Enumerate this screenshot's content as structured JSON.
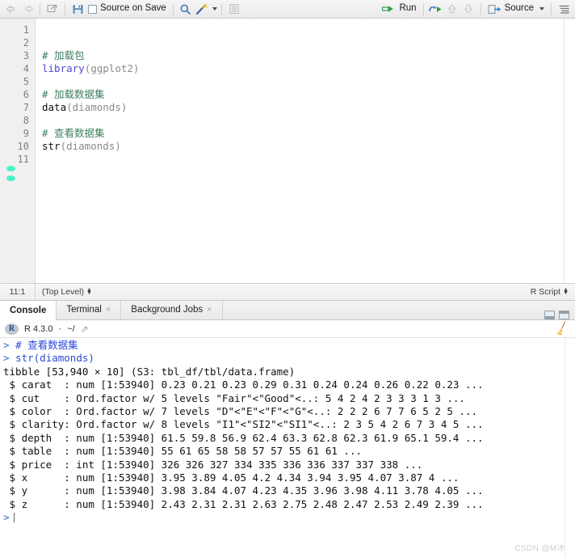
{
  "source_toolbar": {
    "back_icon": "back-arrow-icon",
    "forward_icon": "forward-arrow-icon",
    "popout_icon": "show-in-new-window-icon",
    "save_icon": "save-icon",
    "source_on_save_label": "Source on Save",
    "find_icon": "magnifier-icon",
    "codetools_icon": "magic-wand-icon",
    "compile_report_icon": "compile-report-icon",
    "run_label": "Run",
    "run_icon": "run-icon",
    "rerun_icon": "rerun-icon",
    "prev_chunk_icon": "arrow-up-icon",
    "next_chunk_icon": "arrow-down-icon",
    "source_label": "Source",
    "source_icon": "source-icon",
    "outline_icon": "document-outline-icon"
  },
  "editor": {
    "line_numbers": [
      "1",
      "2",
      "3",
      "4",
      "5",
      "6",
      "7",
      "8",
      "9",
      "10",
      "11"
    ],
    "lines": [
      {
        "n": "1",
        "segments": []
      },
      {
        "n": "2",
        "segments": []
      },
      {
        "n": "3",
        "segments": [
          {
            "t": "# 加载包",
            "c": "cmt"
          }
        ]
      },
      {
        "n": "4",
        "segments": [
          {
            "t": "library",
            "c": "kw"
          },
          {
            "t": "(ggplot2)",
            "c": "paren"
          }
        ]
      },
      {
        "n": "5",
        "segments": []
      },
      {
        "n": "6",
        "segments": [
          {
            "t": "# 加载数据集",
            "c": "cmt"
          }
        ]
      },
      {
        "n": "7",
        "segments": [
          {
            "t": "data",
            "c": "fn"
          },
          {
            "t": "(diamonds)",
            "c": "paren"
          }
        ]
      },
      {
        "n": "8",
        "segments": []
      },
      {
        "n": "9",
        "segments": [
          {
            "t": "# 查看数据集",
            "c": "cmt"
          }
        ]
      },
      {
        "n": "10",
        "segments": [
          {
            "t": "str",
            "c": "fn"
          },
          {
            "t": "(diamonds)",
            "c": "paren"
          }
        ]
      },
      {
        "n": "11",
        "segments": []
      }
    ]
  },
  "source_status": {
    "cursor_position": "11:1",
    "scope": "(Top Level)",
    "file_type": "R Script"
  },
  "console_tabs": [
    {
      "label": "Console",
      "closable": false,
      "active": true
    },
    {
      "label": "Terminal",
      "closable": true,
      "active": false
    },
    {
      "label": "Background Jobs",
      "closable": true,
      "active": false
    }
  ],
  "console_header": {
    "r_logo_text": "R",
    "version": "R 4.3.0",
    "separator": "·",
    "working_dir": "~/",
    "popout_icon": "open-in-new-window-icon",
    "clear_icon": "broom-clear-console-icon"
  },
  "console_output": [
    {
      "type": "input",
      "prompt": "> ",
      "text": "# 查看数据集"
    },
    {
      "type": "input",
      "prompt": "> ",
      "text": "str(diamonds)"
    },
    {
      "type": "output",
      "text": "tibble [53,940 × 10] (S3: tbl_df/tbl/data.frame)"
    },
    {
      "type": "output",
      "text": " $ carat  : num [1:53940] 0.23 0.21 0.23 0.29 0.31 0.24 0.24 0.26 0.22 0.23 ..."
    },
    {
      "type": "output",
      "text": " $ cut    : Ord.factor w/ 5 levels \"Fair\"<\"Good\"<..: 5 4 2 4 2 3 3 3 1 3 ..."
    },
    {
      "type": "output",
      "text": " $ color  : Ord.factor w/ 7 levels \"D\"<\"E\"<\"F\"<\"G\"<..: 2 2 2 6 7 7 6 5 2 5 ..."
    },
    {
      "type": "output",
      "text": " $ clarity: Ord.factor w/ 8 levels \"I1\"<\"SI2\"<\"SI1\"<..: 2 3 5 4 2 6 7 3 4 5 ..."
    },
    {
      "type": "output",
      "text": " $ depth  : num [1:53940] 61.5 59.8 56.9 62.4 63.3 62.8 62.3 61.9 65.1 59.4 ..."
    },
    {
      "type": "output",
      "text": " $ table  : num [1:53940] 55 61 65 58 58 57 57 55 61 61 ..."
    },
    {
      "type": "output",
      "text": " $ price  : int [1:53940] 326 326 327 334 335 336 336 337 337 338 ..."
    },
    {
      "type": "output",
      "text": " $ x      : num [1:53940] 3.95 3.89 4.05 4.2 4.34 3.94 3.95 4.07 3.87 4 ..."
    },
    {
      "type": "output",
      "text": " $ y      : num [1:53940] 3.98 3.84 4.07 4.23 4.35 3.96 3.98 4.11 3.78 4.05 ..."
    },
    {
      "type": "output",
      "text": " $ z      : num [1:53940] 2.43 2.31 2.31 2.63 2.75 2.48 2.47 2.53 2.49 2.39 ..."
    }
  ],
  "console_prompt": ">",
  "watermark": "CSDN @M冰",
  "colors": {
    "comment_green": "#3f7f5f",
    "keyword_blue": "#4a4ad0",
    "console_input_blue": "#2b4ad8",
    "run_green": "#2a9c3a",
    "toolbar_bg": "#eeeeee"
  }
}
